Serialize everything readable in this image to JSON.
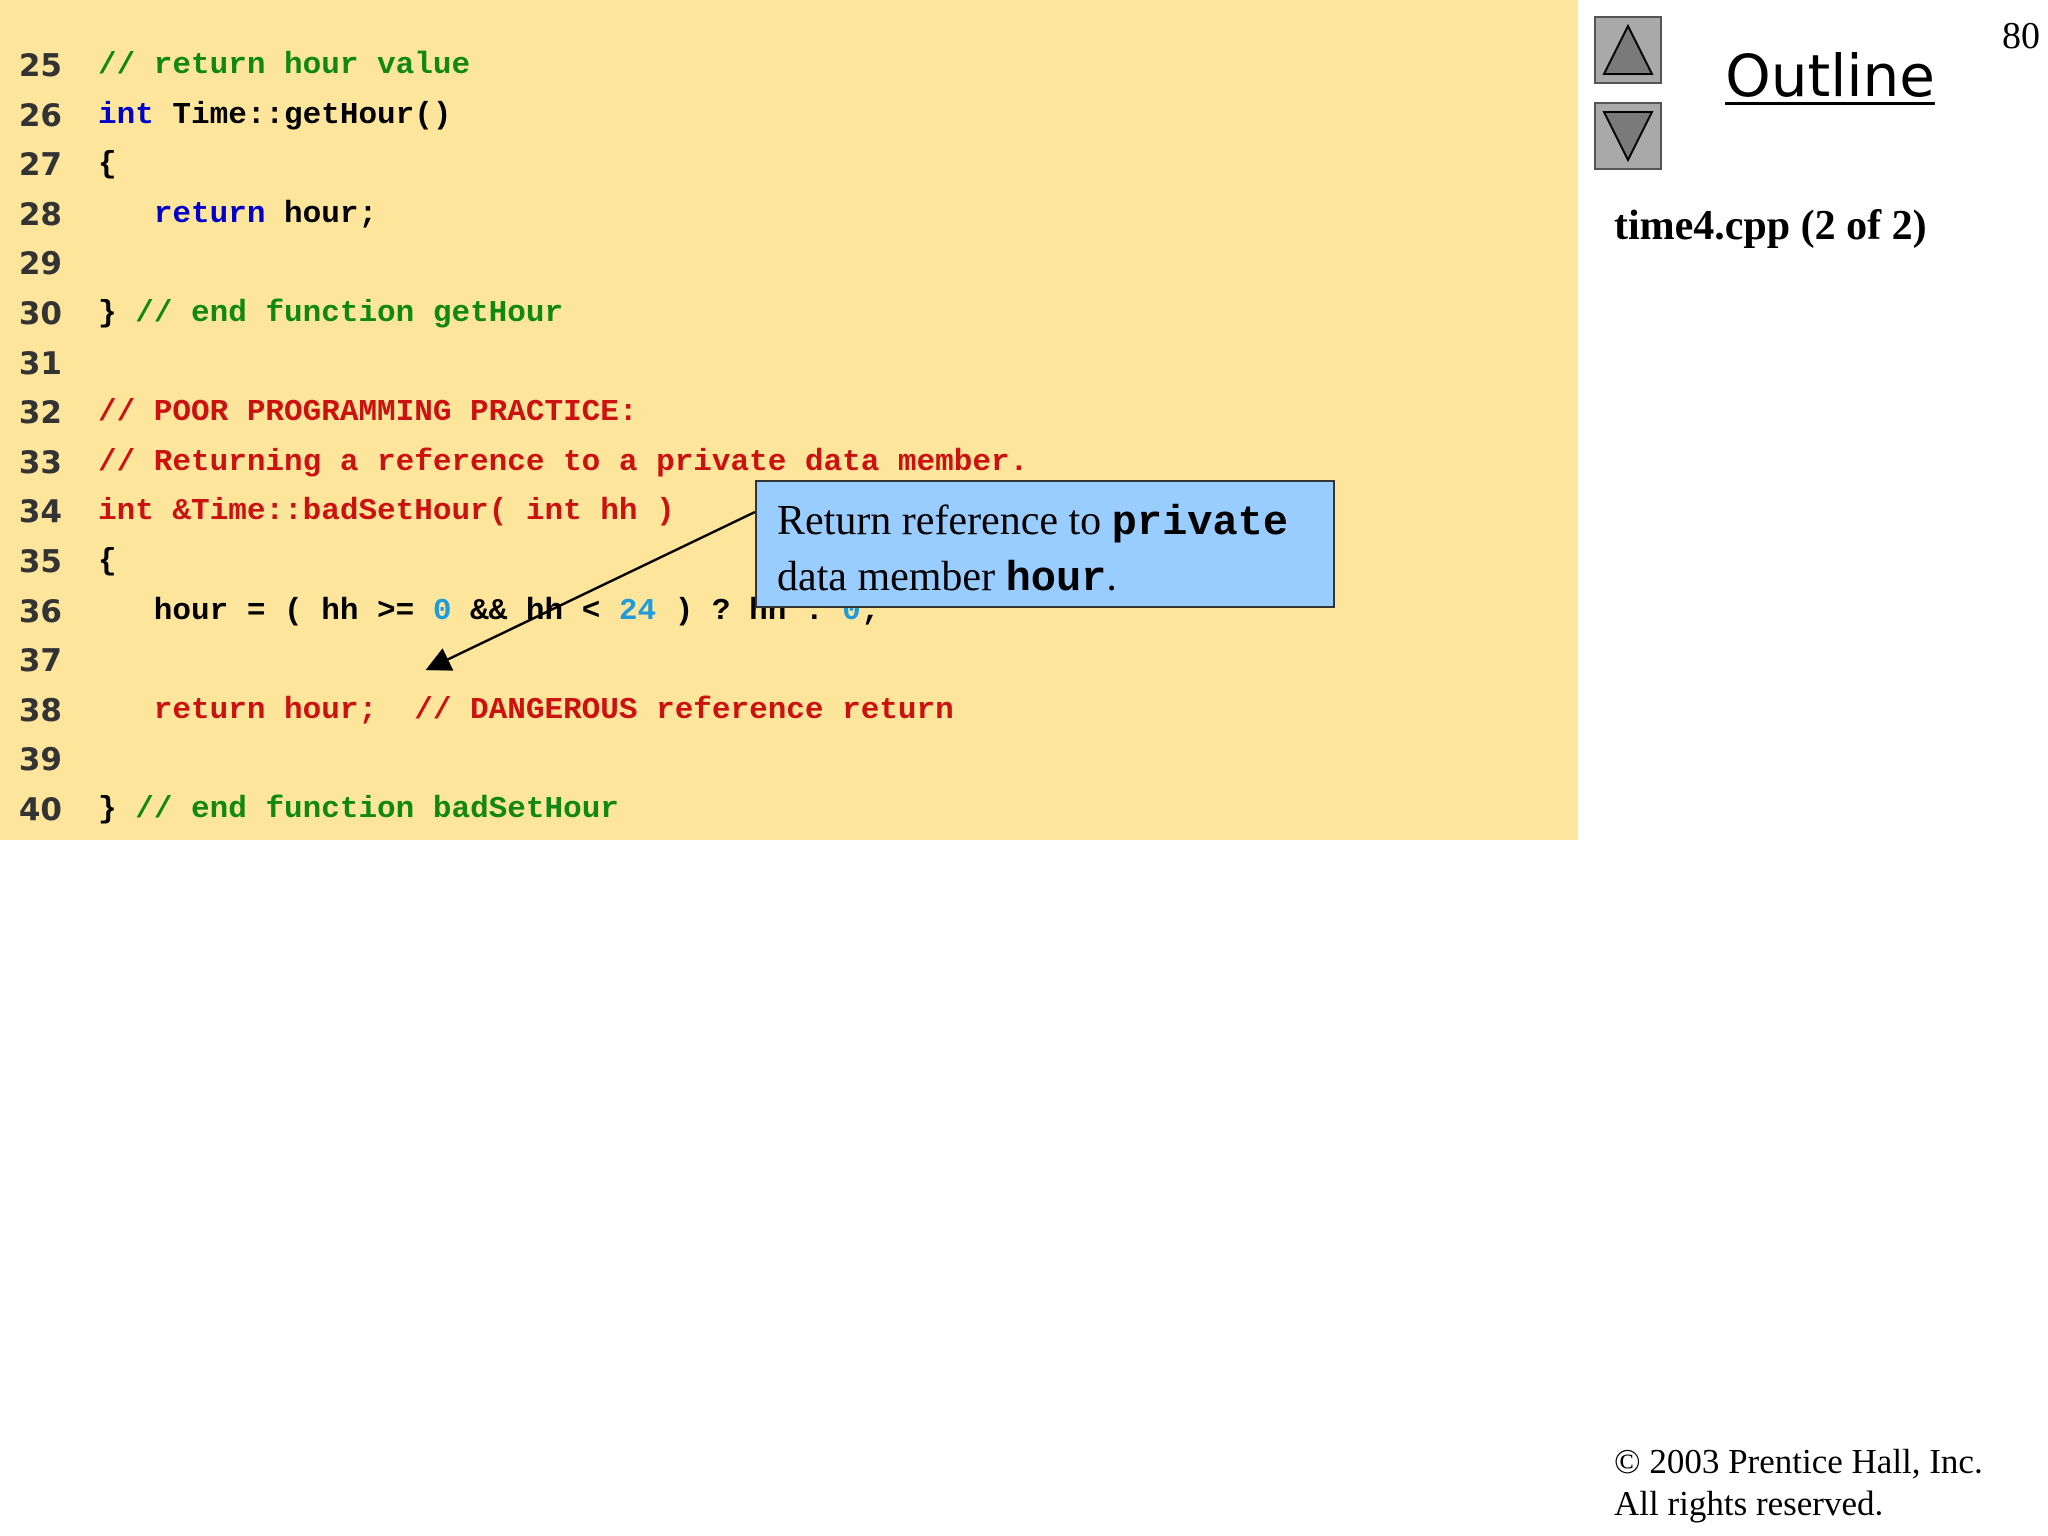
{
  "header": {
    "page_number": "80",
    "outline_title": "Outline",
    "file_label": "time4.cpp (2 of 2)"
  },
  "code_lines": [
    {
      "num": "25",
      "segments": [
        {
          "t": "// return hour value",
          "c": "cm"
        }
      ]
    },
    {
      "num": "26",
      "segments": [
        {
          "t": "int",
          "c": "kw"
        },
        {
          "t": " Time::getHour()",
          "c": "plain"
        }
      ]
    },
    {
      "num": "27",
      "segments": [
        {
          "t": "{",
          "c": "plain"
        }
      ]
    },
    {
      "num": "28",
      "segments": [
        {
          "t": "   ",
          "c": "plain"
        },
        {
          "t": "return",
          "c": "kw"
        },
        {
          "t": " hour;",
          "c": "plain"
        }
      ]
    },
    {
      "num": "29",
      "segments": []
    },
    {
      "num": "30",
      "segments": [
        {
          "t": "} ",
          "c": "plain"
        },
        {
          "t": "// end function getHour",
          "c": "cm"
        }
      ]
    },
    {
      "num": "31",
      "segments": []
    },
    {
      "num": "32",
      "segments": [
        {
          "t": "// POOR PROGRAMMING PRACTICE:",
          "c": "poor"
        }
      ]
    },
    {
      "num": "33",
      "segments": [
        {
          "t": "// Returning a reference to a private data member.",
          "c": "poor"
        }
      ]
    },
    {
      "num": "34",
      "segments": [
        {
          "t": "int &Time::badSetHour( int hh )",
          "c": "poor"
        }
      ]
    },
    {
      "num": "35",
      "segments": [
        {
          "t": "{",
          "c": "plain"
        }
      ]
    },
    {
      "num": "36",
      "segments": [
        {
          "t": "   hour = ( hh >= ",
          "c": "plain"
        },
        {
          "t": "0",
          "c": "num"
        },
        {
          "t": " && hh < ",
          "c": "plain"
        },
        {
          "t": "24",
          "c": "num"
        },
        {
          "t": " ) ? hh : ",
          "c": "plain"
        },
        {
          "t": "0",
          "c": "num"
        },
        {
          "t": ";",
          "c": "plain"
        }
      ]
    },
    {
      "num": "37",
      "segments": []
    },
    {
      "num": "38",
      "segments": [
        {
          "t": "   return hour;  // DANGEROUS reference return",
          "c": "poor"
        }
      ]
    },
    {
      "num": "39",
      "segments": []
    },
    {
      "num": "40",
      "segments": [
        {
          "t": "} ",
          "c": "plain"
        },
        {
          "t": "// end function badSetHour",
          "c": "cm"
        }
      ]
    }
  ],
  "callout": {
    "part1": "Return reference to ",
    "keyword1": "private",
    "part2": "data member ",
    "keyword2": "hour",
    "end": "."
  },
  "footer": {
    "copyright_line1": "© 2003 Prentice Hall, Inc.",
    "copyright_line2": "All rights reserved."
  },
  "nav": {
    "up_icon": "triangle-up-icon",
    "down_icon": "triangle-down-icon"
  },
  "colors": {
    "code_background": "#fde69c",
    "callout_background": "#99ccff",
    "keyword": "#0000cc",
    "comment": "#118811",
    "warning": "#cc1111",
    "number": "#1e9bdc"
  }
}
